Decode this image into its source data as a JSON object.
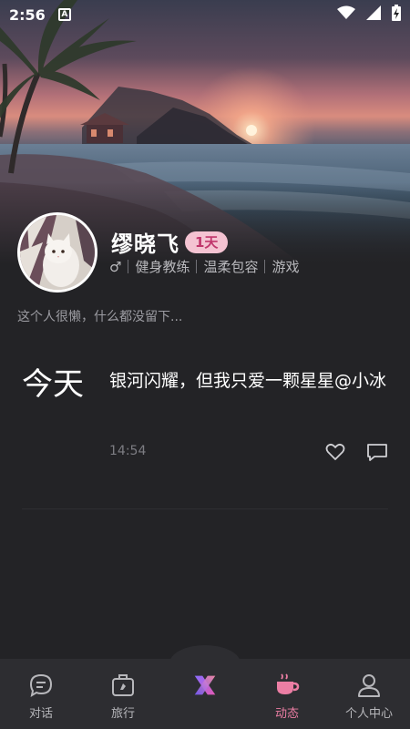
{
  "status_bar": {
    "time": "2:56",
    "notification_letter": "A",
    "icons": [
      "wifi-icon",
      "signal-icon",
      "battery-icon"
    ]
  },
  "profile": {
    "name": "缪晓飞",
    "days_badge": "1天",
    "gender_symbol": "♂",
    "tags": [
      "健身教练",
      "温柔包容",
      "游戏"
    ],
    "bio": "这个人很懒，什么都没留下..."
  },
  "post": {
    "date_label": "今天",
    "text": "银河闪耀，但我只爱一颗星星@小冰",
    "time": "14:54"
  },
  "nav": {
    "items": [
      {
        "label": "对话",
        "icon": "chat-bubble-icon"
      },
      {
        "label": "旅行",
        "icon": "luggage-icon"
      },
      {
        "label": "",
        "icon": "app-logo-icon"
      },
      {
        "label": "动态",
        "icon": "coffee-cup-icon"
      },
      {
        "label": "个人中心",
        "icon": "person-icon"
      }
    ],
    "active_index": 3
  },
  "colors": {
    "background": "#232326",
    "nav_background": "#2d2d31",
    "accent_pink": "#ec7ea4",
    "badge_bg": "#f4c3d2",
    "badge_text": "#c0366c"
  }
}
